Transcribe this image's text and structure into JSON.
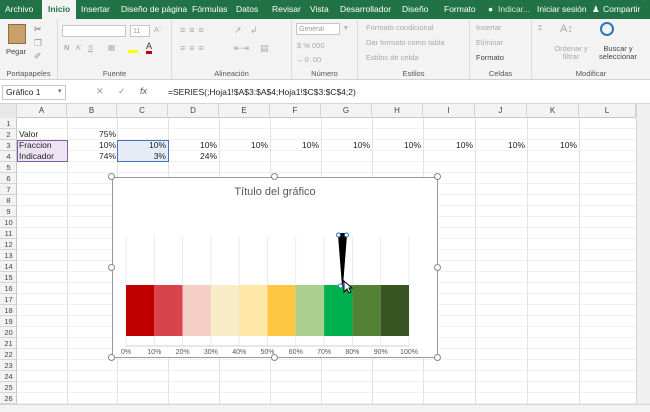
{
  "tabs": [
    "Archivo",
    "Inicio",
    "Insertar",
    "Diseño de página",
    "Fórmulas",
    "Datos",
    "Revisar",
    "Vista",
    "Desarrollador",
    "Diseño",
    "Formato",
    "Indicar...",
    "Iniciar sesión",
    "Compartir"
  ],
  "ribbon": {
    "paste_label": "Pegar",
    "clipboard_label": "Portapapeles",
    "font_label": "Fuente",
    "font_size": "11",
    "alignment_label": "Alineación",
    "number_format": "General",
    "number_label": "Número",
    "styles": {
      "conditional": "Formato condicional",
      "table": "Dar formato como tabla",
      "cell": "Estilos de celda",
      "label": "Estilos"
    },
    "cells": {
      "insert": "Insertar",
      "delete": "Eliminar",
      "format": "Formato",
      "label": "Celdas"
    },
    "editing": {
      "sort": "Ordenar y filtrar",
      "find": "Buscar y seleccionar",
      "label": "Modificar"
    }
  },
  "namebox": "Gráfico 1",
  "formula": "=SERIES(;Hoja1!$A$3:$A$4;Hoja1!$C$3:$C$4;2)",
  "columns": [
    "A",
    "B",
    "C",
    "D",
    "E",
    "F",
    "G",
    "H",
    "I",
    "J",
    "K",
    "L"
  ],
  "rows": [
    "1",
    "2",
    "3",
    "4",
    "5",
    "6",
    "7",
    "8",
    "9",
    "10",
    "11",
    "12",
    "13",
    "14",
    "15",
    "16",
    "17",
    "18",
    "19",
    "20",
    "21",
    "22",
    "23",
    "24",
    "25",
    "26"
  ],
  "cells": {
    "a2": "Valor",
    "b2": "75%",
    "a3": "Fraccion",
    "b3": "10%",
    "c3": "10%",
    "d3": "10%",
    "e3": "10%",
    "f3": "10%",
    "g3": "10%",
    "h3": "10%",
    "i3": "10%",
    "j3": "10%",
    "k3": "10%",
    "a4": "Indicador",
    "b4": "74%",
    "c4": "3%",
    "d4": "24%"
  },
  "chart_data": {
    "type": "bar",
    "title": "Título del gráfico",
    "categories": [
      "0%",
      "10%",
      "20%",
      "30%",
      "40%",
      "50%",
      "60%",
      "70%",
      "80%",
      "90%",
      "100%"
    ],
    "segments": [
      10,
      10,
      10,
      10,
      10,
      10,
      10,
      10,
      10,
      10
    ],
    "segment_colors": [
      "#c00000",
      "#d9434c",
      "#f5cfc3",
      "#faebc8",
      "#fde7a9",
      "#fcc844",
      "#a9d08e",
      "#00b050",
      "#548235",
      "#375623"
    ],
    "indicator_value": 75,
    "indicator_width": 3,
    "xlim": [
      0,
      100
    ],
    "grid": true
  }
}
